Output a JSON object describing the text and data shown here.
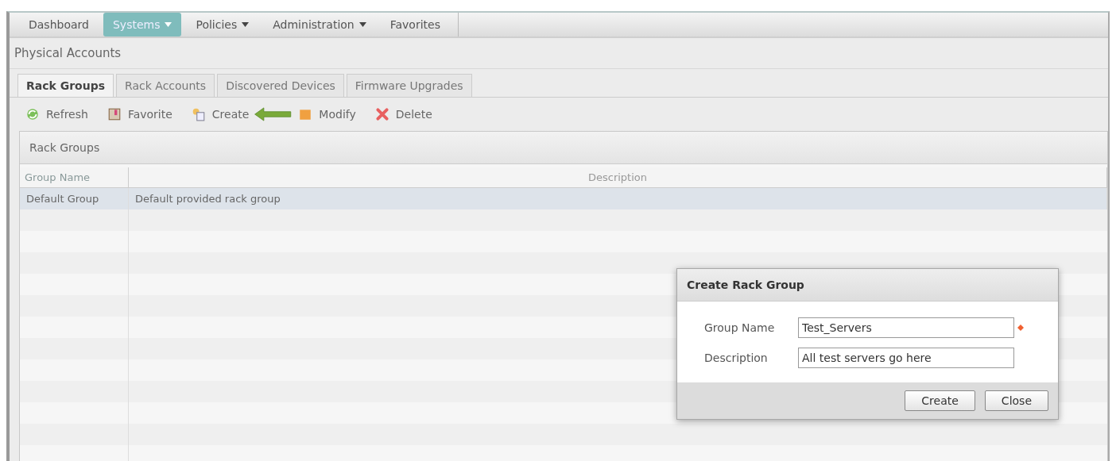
{
  "nav": [
    {
      "label": "Dashboard",
      "selected": false,
      "dropdown": false
    },
    {
      "label": "Systems",
      "selected": true,
      "dropdown": true
    },
    {
      "label": "Policies",
      "selected": false,
      "dropdown": true
    },
    {
      "label": "Administration",
      "selected": false,
      "dropdown": true
    },
    {
      "label": "Favorites",
      "selected": false,
      "dropdown": false
    }
  ],
  "page_title": "Physical Accounts",
  "tabs": [
    {
      "label": "Rack Groups",
      "selected": true
    },
    {
      "label": "Rack Accounts",
      "selected": false
    },
    {
      "label": "Discovered Devices",
      "selected": false
    },
    {
      "label": "Firmware Upgrades",
      "selected": false
    }
  ],
  "toolbar": [
    {
      "kind": "refresh",
      "label": "Refresh"
    },
    {
      "kind": "favorite",
      "label": "Favorite"
    },
    {
      "kind": "create",
      "label": "Create"
    },
    {
      "kind": "modify",
      "label": "Modify"
    },
    {
      "kind": "delete",
      "label": "Delete"
    }
  ],
  "panel": {
    "title": "Rack Groups",
    "table": {
      "columns": [
        "Group Name",
        "Description"
      ],
      "rows": [
        {
          "cells": [
            "Default Group",
            "Default provided rack group"
          ],
          "selected": true
        }
      ]
    }
  },
  "dialog": {
    "title": "Create Rack Group",
    "fields": [
      {
        "label": "Group Name",
        "value": "Test_Servers",
        "required": true
      },
      {
        "label": "Description",
        "value": "All test servers go here",
        "required": false
      }
    ],
    "buttons": [
      "Create",
      "Close"
    ]
  }
}
